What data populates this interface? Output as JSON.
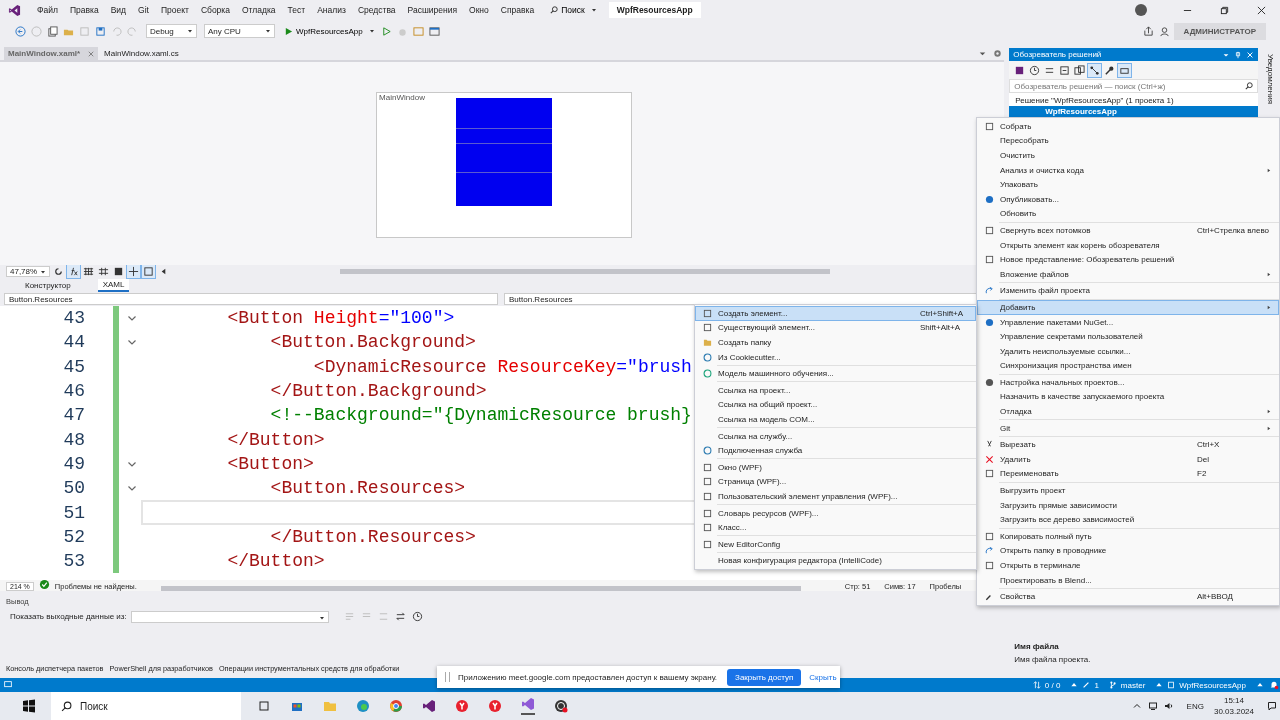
{
  "menu_bar": {
    "items": [
      "Файл",
      "Правка",
      "Вид",
      "Git",
      "Проект",
      "Сборка",
      "Отладка",
      "Тест",
      "Анализ",
      "Средства",
      "Расширения",
      "Окно",
      "Справка"
    ],
    "search": "Поиск",
    "title": "WpfResourcesApp"
  },
  "toolbar": {
    "configuration": "Debug",
    "platform": "Any CPU",
    "run_target": "WpfResourcesApp",
    "admin_badge": "АДМИНИСТРАТОР"
  },
  "doc_tabs": [
    {
      "label": "MainWindow.xaml*",
      "selected": true
    },
    {
      "label": "MainWindow.xaml.cs",
      "selected": false
    }
  ],
  "designer": {
    "window_title": "MainWindow",
    "zoom": "47,78%"
  },
  "view_tabs": [
    {
      "label": "Конструктор",
      "selected": false
    },
    {
      "label": "XAML",
      "selected": true
    }
  ],
  "nav_bar": [
    "Button.Resources",
    "Button.Resources"
  ],
  "code_lines": [
    {
      "number": "43",
      "fold": true,
      "current": false,
      "tokens": [
        {
          "text": "        <Button ",
          "kind": "tag"
        },
        {
          "text": "Height",
          "kind": "attr"
        },
        {
          "text": "=\"100\">",
          "kind": "value"
        }
      ]
    },
    {
      "number": "44",
      "fold": true,
      "current": false,
      "tokens": [
        {
          "text": "            <Button.Background>",
          "kind": "tag"
        }
      ]
    },
    {
      "number": "45",
      "fold": false,
      "current": false,
      "tokens": [
        {
          "text": "                <DynamicResource ",
          "kind": "tag"
        },
        {
          "text": "ResourceKey",
          "kind": "attr"
        },
        {
          "text": "=\"brush",
          "kind": "value"
        }
      ]
    },
    {
      "number": "46",
      "fold": false,
      "current": false,
      "tokens": [
        {
          "text": "            </Button.Background>",
          "kind": "tag"
        }
      ]
    },
    {
      "number": "47",
      "fold": false,
      "current": false,
      "tokens": [
        {
          "text": "            <!--Background=\"{DynamicResource brush}",
          "kind": "comment"
        }
      ]
    },
    {
      "number": "48",
      "fold": false,
      "current": false,
      "tokens": [
        {
          "text": "        </Button>",
          "kind": "tag"
        }
      ]
    },
    {
      "number": "49",
      "fold": true,
      "current": false,
      "tokens": [
        {
          "text": "        <Button>",
          "kind": "tag"
        }
      ]
    },
    {
      "number": "50",
      "fold": true,
      "current": false,
      "tokens": [
        {
          "text": "            <Button.Resources>",
          "kind": "tag"
        }
      ]
    },
    {
      "number": "51",
      "fold": false,
      "current": true
    },
    {
      "number": "52",
      "fold": false,
      "current": false,
      "tokens": [
        {
          "text": "            </Button.Resources>",
          "kind": "tag"
        }
      ]
    },
    {
      "number": "53",
      "fold": false,
      "current": false,
      "tokens": [
        {
          "text": "        </Button>",
          "kind": "tag"
        }
      ]
    }
  ],
  "editor_status": {
    "zoom": "214 %",
    "issues": "Проблемы не найдены.",
    "line": "Стр: 51",
    "column": "Симв: 17",
    "whitespace": "Пробелы"
  },
  "output": {
    "title": "Вывод",
    "source_label": "Показать выходные данные из:"
  },
  "bottom_tabs": [
    "Консоль диспетчера пакетов",
    "PowerShell для разработчиков",
    "Операции инструментальных средств для обработки"
  ],
  "solution_explorer": {
    "title": "Обозреватель решений",
    "search_placeholder": "Обозреватель решений — поиск (Ctrl+ж)",
    "tree": [
      {
        "label": "Решение \"WpfResourcesApp\" (1 проекта 1)",
        "selected": false,
        "children": [
          {
            "label": "WpfResourcesApp",
            "selected": true
          }
        ]
      }
    ]
  },
  "properties": {
    "name": "Имя файла",
    "description": "Имя файла проекта."
  },
  "notifications_tab": "Уведомления",
  "context_menu": {
    "groups": [
      [
        {
          "label": "Собрать",
          "submenu": false,
          "selected": false
        },
        {
          "label": "Пересобрать",
          "submenu": false,
          "selected": false
        },
        {
          "label": "Очистить",
          "submenu": false,
          "selected": false
        },
        {
          "label": "Анализ и очистка кода",
          "submenu": true,
          "selected": false
        },
        {
          "label": "Упаковать",
          "submenu": false,
          "selected": false
        },
        {
          "label": "Опубликовать...",
          "submenu": false,
          "selected": false
        },
        {
          "label": "Обновить",
          "submenu": false,
          "selected": false
        }
      ],
      [
        {
          "label": "Свернуть всех потомков",
          "shortcut": "Ctrl+Стрелка влево",
          "submenu": false,
          "selected": false
        },
        {
          "label": "Открыть элемент как корень обозревателя",
          "submenu": false,
          "selected": false
        },
        {
          "label": "Новое представление: Обозреватель решений",
          "submenu": false,
          "selected": false
        },
        {
          "label": "Вложение файлов",
          "submenu": true,
          "selected": false
        }
      ],
      [
        {
          "label": "Изменить файл проекта",
          "submenu": false,
          "selected": false
        }
      ],
      [
        {
          "label": "Добавить",
          "submenu": true,
          "selected": true
        },
        {
          "label": "Управление пакетами NuGet...",
          "submenu": false,
          "selected": false
        },
        {
          "label": "Управление секретами пользователей",
          "submenu": false,
          "selected": false
        },
        {
          "label": "Удалить неиспользуемые ссылки...",
          "submenu": false,
          "selected": false
        },
        {
          "label": "Синхронизация пространства имен",
          "submenu": false,
          "selected": false
        }
      ],
      [
        {
          "label": "Настройка начальных проектов...",
          "submenu": false,
          "selected": false
        },
        {
          "label": "Назначить в качестве запускаемого проекта",
          "submenu": false,
          "selected": false
        },
        {
          "label": "Отладка",
          "submenu": true,
          "selected": false
        }
      ],
      [
        {
          "label": "Git",
          "submenu": true,
          "selected": false
        }
      ],
      [
        {
          "label": "Вырезать",
          "shortcut": "Ctrl+X",
          "submenu": false,
          "selected": false
        },
        {
          "label": "Удалить",
          "shortcut": "Del",
          "submenu": false,
          "selected": false
        },
        {
          "label": "Переименовать",
          "shortcut": "F2",
          "submenu": false,
          "selected": false
        }
      ],
      [
        {
          "label": "Выгрузить проект",
          "submenu": false,
          "selected": false
        },
        {
          "label": "Загрузить прямые зависимости",
          "submenu": false,
          "selected": false
        },
        {
          "label": "Загрузить все дерево зависимостей",
          "submenu": false,
          "selected": false
        }
      ],
      [
        {
          "label": "Копировать полный путь",
          "submenu": false,
          "selected": false
        },
        {
          "label": "Открыть папку в проводнике",
          "submenu": false,
          "selected": false
        },
        {
          "label": "Открыть в терминале",
          "submenu": false,
          "selected": false
        },
        {
          "label": "Проектировать в Blend...",
          "submenu": false,
          "selected": false
        }
      ],
      [
        {
          "label": "Свойства",
          "shortcut": "Alt+ВВОД",
          "submenu": false,
          "selected": false
        }
      ]
    ]
  },
  "submenu": {
    "groups": [
      [
        {
          "label": "Создать элемент...",
          "shortcut": "Ctrl+Shift+A",
          "selected": true
        },
        {
          "label": "Существующий элемент...",
          "shortcut": "Shift+Alt+A",
          "selected": false
        },
        {
          "label": "Создать папку",
          "selected": false
        },
        {
          "label": "Из Cookiecutter...",
          "selected": false
        }
      ],
      [
        {
          "label": "Модель машинного обучения...",
          "selected": false
        }
      ],
      [
        {
          "label": "Ссылка на проект...",
          "selected": false
        },
        {
          "label": "Ссылка на общий проект...",
          "selected": false
        },
        {
          "label": "Ссылка на модель COM...",
          "selected": false
        }
      ],
      [
        {
          "label": "Ссылка на службу...",
          "selected": false
        },
        {
          "label": "Подключенная служба",
          "selected": false
        }
      ],
      [
        {
          "label": "Окно (WPF)",
          "selected": false
        },
        {
          "label": "Страница (WPF)...",
          "selected": false
        },
        {
          "label": "Пользовательский элемент управления (WPF)...",
          "selected": false
        }
      ],
      [
        {
          "label": "Словарь ресурсов (WPF)...",
          "selected": false
        },
        {
          "label": "Класс...",
          "selected": false
        }
      ],
      [
        {
          "label": "New EditorConfig",
          "selected": false
        }
      ],
      [
        {
          "label": "Новая конфигурация редактора (IntelliCode)",
          "selected": false
        }
      ]
    ]
  },
  "share_banner": {
    "message": "Приложению meet.google.com предоставлен доступ к вашему экрану.",
    "stop_button": "Закрыть доступ",
    "hide_link": "Скрыть"
  },
  "status_bar": {
    "changes": "0 / 0",
    "edits": "1",
    "branch": "master",
    "repository": "WpfResourcesApp"
  },
  "taskbar": {
    "search_placeholder": "Поиск",
    "language": "ENG",
    "time": "15:14",
    "date": "30.03.2024"
  }
}
